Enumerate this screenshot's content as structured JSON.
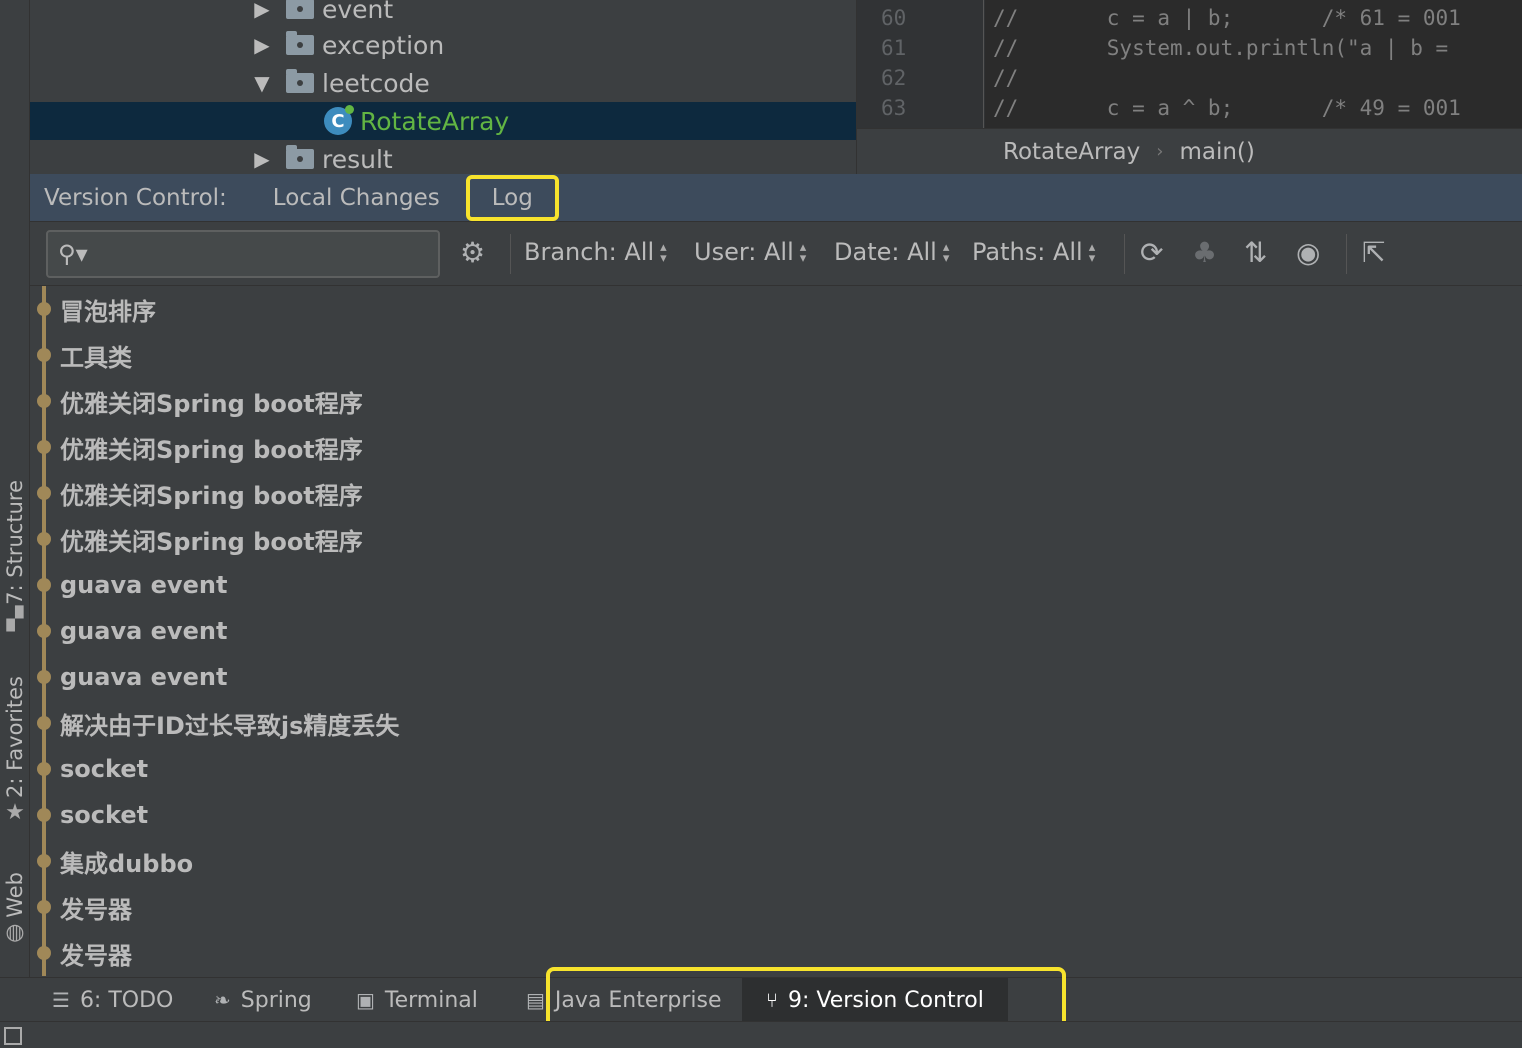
{
  "side_tabs": [
    {
      "label": "7: Structure",
      "icon": "structure-icon"
    },
    {
      "label": "2: Favorites",
      "icon": "star-icon"
    },
    {
      "label": "Web",
      "icon": "globe-icon"
    }
  ],
  "project_tree": [
    {
      "name": "event",
      "type": "folder",
      "expanded": false
    },
    {
      "name": "exception",
      "type": "folder",
      "expanded": false
    },
    {
      "name": "leetcode",
      "type": "folder",
      "expanded": true
    },
    {
      "name": "RotateArray",
      "type": "class",
      "selected": true
    },
    {
      "name": "result",
      "type": "folder",
      "expanded": false
    }
  ],
  "editor": {
    "line_numbers": [
      "60",
      "61",
      "62",
      "63"
    ],
    "lines": [
      "//       c = a | b;       /* 61 = 001",
      "//       System.out.println(\"a | b = ",
      "//",
      "//       c = a ^ b;       /* 49 = 001"
    ],
    "breadcrumb": [
      "RotateArray",
      "main()"
    ]
  },
  "version_control": {
    "title": "Version Control:",
    "tabs": [
      "Local Changes",
      "Log"
    ],
    "active_tab": "Log"
  },
  "toolbar": {
    "search_value": "",
    "filters": [
      "Branch: All",
      "User: All",
      "Date: All",
      "Paths: All"
    ]
  },
  "commits": [
    "冒泡排序",
    "工具类",
    "优雅关闭Spring boot程序",
    "优雅关闭Spring boot程序",
    "优雅关闭Spring boot程序",
    "优雅关闭Spring boot程序",
    "guava event",
    "guava event",
    "guava event",
    "解决由于ID过长导致js精度丢失",
    "socket",
    "socket",
    "集成dubbo",
    "发号器",
    "发号器"
  ],
  "bottom_bar": {
    "todo": "6: TODO",
    "spring": "Spring",
    "terminal": "Terminal",
    "java_enterprise": "Java Enterprise",
    "version_control": "9: Version Control"
  },
  "colors": {
    "highlight": "#f7e32d",
    "graph": "#a08858",
    "selection": "#0d293e",
    "class_name": "#62b543"
  }
}
